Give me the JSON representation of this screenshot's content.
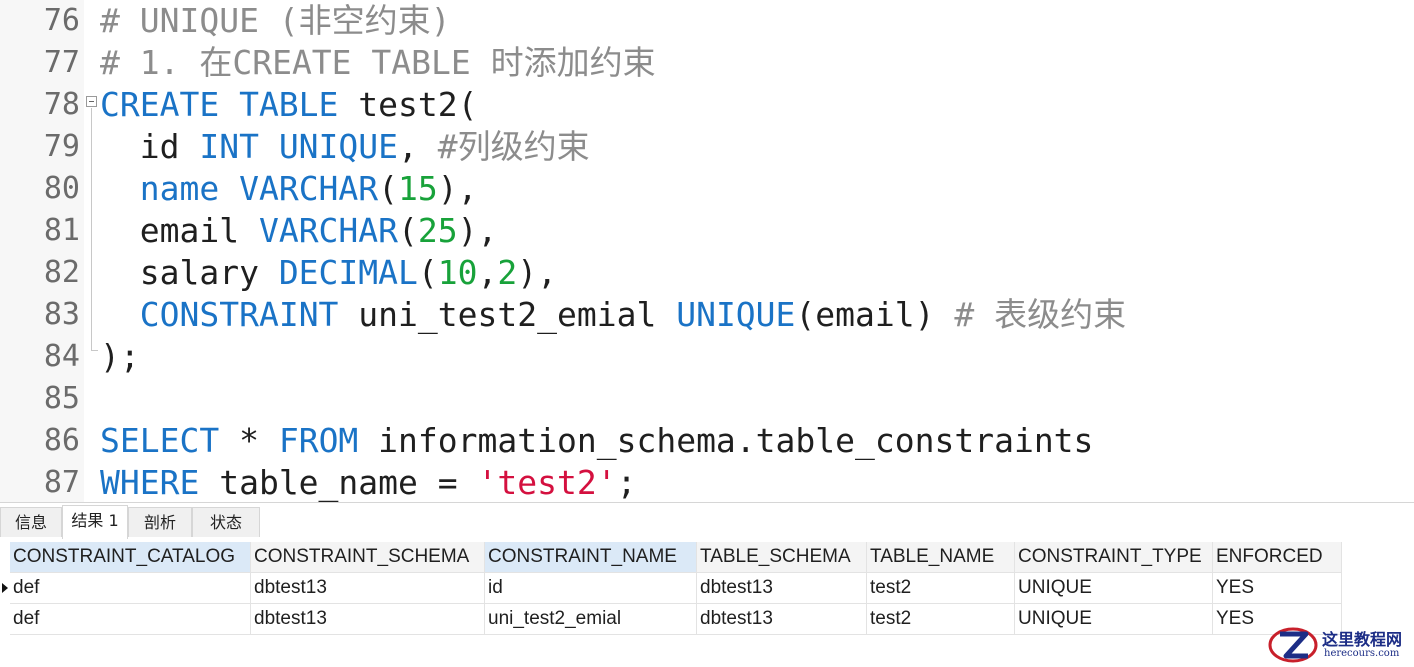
{
  "editor": {
    "lines": [
      {
        "num": "76",
        "tokens": [
          {
            "t": "# UNIQUE (非空约束)",
            "c": "cm"
          }
        ]
      },
      {
        "num": "77",
        "tokens": [
          {
            "t": "# 1. 在CREATE TABLE 时添加约束",
            "c": "cm"
          }
        ]
      },
      {
        "num": "78",
        "tokens": [
          {
            "t": "CREATE TABLE",
            "c": "kw"
          },
          {
            "t": " test2(",
            "c": "tx"
          }
        ]
      },
      {
        "num": "79",
        "tokens": [
          {
            "t": "  id ",
            "c": "tx"
          },
          {
            "t": "INT UNIQUE",
            "c": "kw"
          },
          {
            "t": ", ",
            "c": "tx"
          },
          {
            "t": "#列级约束",
            "c": "cm"
          }
        ]
      },
      {
        "num": "80",
        "tokens": [
          {
            "t": "  ",
            "c": "tx"
          },
          {
            "t": "name VARCHAR",
            "c": "kw"
          },
          {
            "t": "(",
            "c": "tx"
          },
          {
            "t": "15",
            "c": "num"
          },
          {
            "t": "),",
            "c": "tx"
          }
        ]
      },
      {
        "num": "81",
        "tokens": [
          {
            "t": "  email ",
            "c": "tx"
          },
          {
            "t": "VARCHAR",
            "c": "kw"
          },
          {
            "t": "(",
            "c": "tx"
          },
          {
            "t": "25",
            "c": "num"
          },
          {
            "t": "),",
            "c": "tx"
          }
        ]
      },
      {
        "num": "82",
        "tokens": [
          {
            "t": "  salary ",
            "c": "tx"
          },
          {
            "t": "DECIMAL",
            "c": "kw"
          },
          {
            "t": "(",
            "c": "tx"
          },
          {
            "t": "10",
            "c": "num"
          },
          {
            "t": ",",
            "c": "tx"
          },
          {
            "t": "2",
            "c": "num"
          },
          {
            "t": "),",
            "c": "tx"
          }
        ]
      },
      {
        "num": "83",
        "tokens": [
          {
            "t": "  ",
            "c": "tx"
          },
          {
            "t": "CONSTRAINT",
            "c": "kw"
          },
          {
            "t": " uni_test2_emial ",
            "c": "tx"
          },
          {
            "t": "UNIQUE",
            "c": "kw"
          },
          {
            "t": "(email) ",
            "c": "tx"
          },
          {
            "t": "# 表级约束",
            "c": "cm"
          }
        ]
      },
      {
        "num": "84",
        "tokens": [
          {
            "t": ");",
            "c": "tx"
          }
        ]
      },
      {
        "num": "85",
        "tokens": []
      },
      {
        "num": "86",
        "tokens": [
          {
            "t": "SELECT",
            "c": "kw"
          },
          {
            "t": " * ",
            "c": "tx"
          },
          {
            "t": "FROM",
            "c": "kw"
          },
          {
            "t": " information_schema.table_constraints",
            "c": "tx"
          }
        ]
      },
      {
        "num": "87",
        "tokens": [
          {
            "t": "WHERE",
            "c": "kw"
          },
          {
            "t": " table_name = ",
            "c": "tx"
          },
          {
            "t": "'test2'",
            "c": "str"
          },
          {
            "t": ";",
            "c": "tx"
          }
        ]
      }
    ]
  },
  "tabs": {
    "info": "信息",
    "result1": "结果 1",
    "profile": "剖析",
    "status": "状态"
  },
  "results": {
    "columns": [
      "CONSTRAINT_CATALOG",
      "CONSTRAINT_SCHEMA",
      "CONSTRAINT_NAME",
      "TABLE_SCHEMA",
      "TABLE_NAME",
      "CONSTRAINT_TYPE",
      "ENFORCED"
    ],
    "rows": [
      [
        "def",
        "dbtest13",
        "id",
        "dbtest13",
        "test2",
        "UNIQUE",
        "YES"
      ],
      [
        "def",
        "dbtest13",
        "uni_test2_emial",
        "dbtest13",
        "test2",
        "UNIQUE",
        "YES"
      ]
    ]
  },
  "watermark": {
    "title": "这里教程网",
    "url": "herecours.com"
  },
  "colors": {
    "keyword": "#1a73c6",
    "comment": "#8c8c8c",
    "number": "#18a23a",
    "string": "#d4103f",
    "logo_red": "#c8202b",
    "logo_blue": "#1c2d86"
  }
}
